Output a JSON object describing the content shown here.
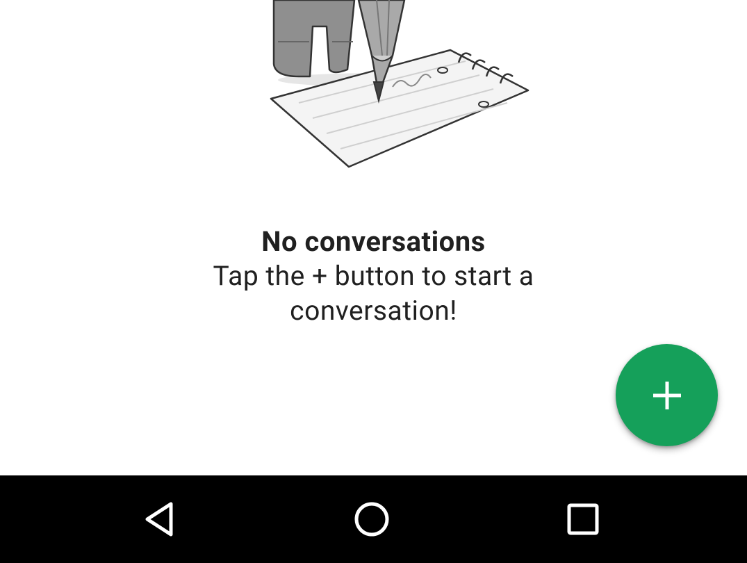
{
  "empty_state": {
    "title": "No conversations",
    "subtitle_line1": "Tap the + button to start a",
    "subtitle_line2": "conversation!",
    "illustration_icon": "pencil-writing-on-notepad-illustration"
  },
  "fab": {
    "icon": "plus-icon",
    "color": "#15a05a"
  },
  "navigation_bar": {
    "background": "#000000",
    "buttons": [
      {
        "icon": "back-triangle-icon"
      },
      {
        "icon": "home-circle-icon"
      },
      {
        "icon": "recents-square-icon"
      }
    ]
  }
}
